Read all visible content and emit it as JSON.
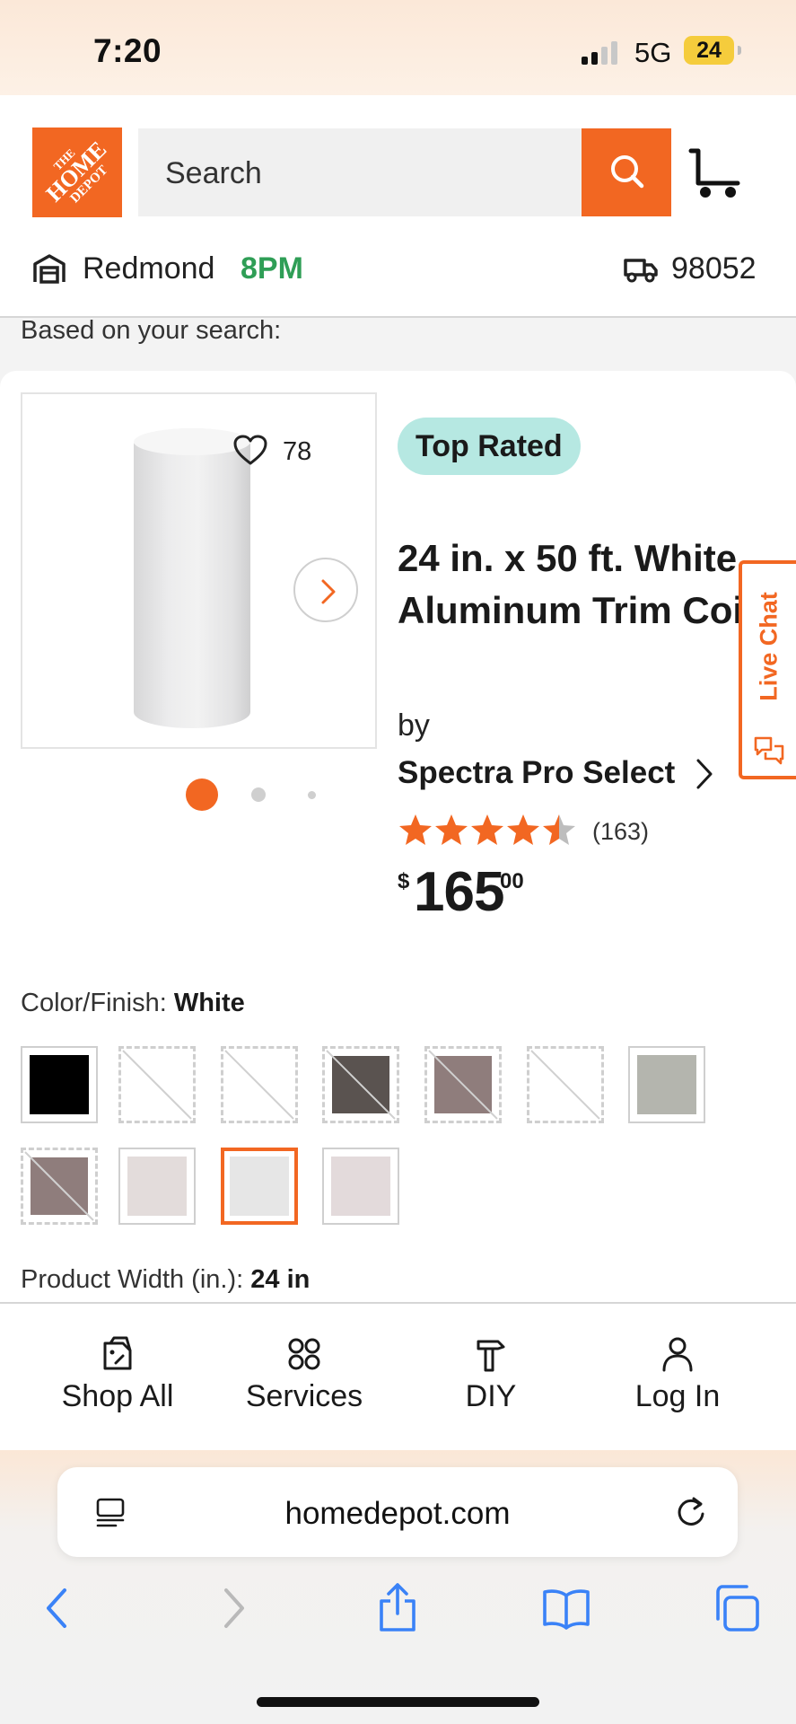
{
  "status_bar": {
    "time": "7:20",
    "network": "5G",
    "battery": "24"
  },
  "header": {
    "logo_lines": [
      "THE",
      "HOME",
      "DEPOT"
    ],
    "search_placeholder": "Search",
    "store_name": "Redmond",
    "store_hours": "8PM",
    "zip_code": "98052"
  },
  "section_label": "Based on your search:",
  "product": {
    "badge": "Top Rated",
    "title": "24 in. x 50 ft. White Aluminum Trim Coil",
    "by_label": "by",
    "brand": "Spectra Pro Select",
    "favorites_count": "78",
    "rating_stars": 4.5,
    "rating_count": "(163)",
    "price_symbol": "$",
    "price_dollars": "165",
    "price_cents": "00",
    "image_page": 1,
    "image_pages": 3
  },
  "color_finish": {
    "label": "Color/Finish:",
    "selected": "White",
    "swatches": [
      {
        "color": "#000000",
        "style": "solid",
        "slash": false
      },
      {
        "color": "#ffffff",
        "style": "dashed",
        "slash": true
      },
      {
        "color": "#ffffff",
        "style": "dashed",
        "slash": true
      },
      {
        "color": "#5a5350",
        "style": "dashed",
        "slash": true
      },
      {
        "color": "#8f7d7c",
        "style": "dashed",
        "slash": true
      },
      {
        "color": "#ffffff",
        "style": "dashed",
        "slash": true
      },
      {
        "color": "#b4b5ae",
        "style": "solid",
        "slash": false
      },
      {
        "color": "#8f7d7c",
        "style": "dashed",
        "slash": true
      },
      {
        "color": "#e3dcdb",
        "style": "solid",
        "slash": false
      },
      {
        "color": "#e6e6e6",
        "style": "selected",
        "slash": false
      },
      {
        "color": "#e3dadb",
        "style": "solid",
        "slash": false
      }
    ]
  },
  "product_width": {
    "label": "Product Width (in.):",
    "value": "24 in"
  },
  "live_chat": "Live Chat",
  "bottom_nav": [
    {
      "label": "Shop All",
      "icon": "shop-all-icon"
    },
    {
      "label": "Services",
      "icon": "services-icon"
    },
    {
      "label": "DIY",
      "icon": "diy-icon"
    },
    {
      "label": "Log In",
      "icon": "user-icon"
    }
  ],
  "browser": {
    "url": "homedepot.com"
  },
  "colors": {
    "brand_orange": "#f26722",
    "store_hours_green": "#2f9e56",
    "badge_teal": "#b6e8e2",
    "ios_blue": "#3a82f7"
  }
}
